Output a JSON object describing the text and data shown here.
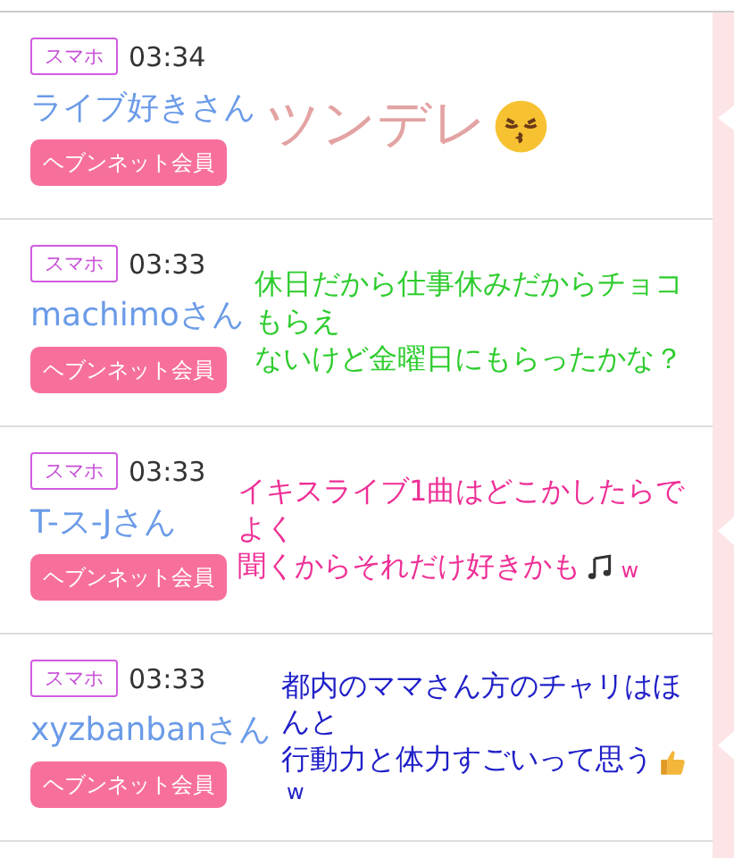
{
  "comments": [
    {
      "device": "スマホ",
      "time": "03:34",
      "name": "ライブ好きさん",
      "member_button": "ヘブンネット会員",
      "caption": {
        "color": "#e3a3a3",
        "lines": [
          {
            "text": "ツンデレ",
            "kind": "kiss_face"
          }
        ]
      }
    },
    {
      "device": "スマホ",
      "time": "03:33",
      "name": "machimoさん",
      "member_button": "ヘブンネット会員",
      "caption": {
        "color": "#2ecc2e",
        "lines": [
          {
            "text": "休日だから仕事休みだからチョコもらえ",
            "kind": "plain"
          },
          {
            "text": "ないけど金曜日にもらったかな？",
            "kind": "plain"
          }
        ]
      }
    },
    {
      "device": "スマホ",
      "time": "03:33",
      "name": "T-ス-Jさん",
      "member_button": "ヘブンネット会員",
      "caption": {
        "color": "#ee2f96",
        "lines": [
          {
            "text": "イキスライブ1曲はどこかしたらでよく",
            "kind": "plain"
          },
          {
            "text": "聞くからそれだけ好きかも",
            "kind": "music_notes",
            "tail": "w"
          }
        ]
      }
    },
    {
      "device": "スマホ",
      "time": "03:33",
      "name": "xyzbanbanさん",
      "member_button": "ヘブンネット会員",
      "caption": {
        "color": "#2020c8",
        "lines": [
          {
            "text": "都内のママさん方のチャリはほんと",
            "kind": "plain"
          },
          {
            "text": "行動力と体力すごいって思う",
            "kind": "thumbs_up",
            "tail": "w"
          }
        ]
      }
    }
  ]
}
